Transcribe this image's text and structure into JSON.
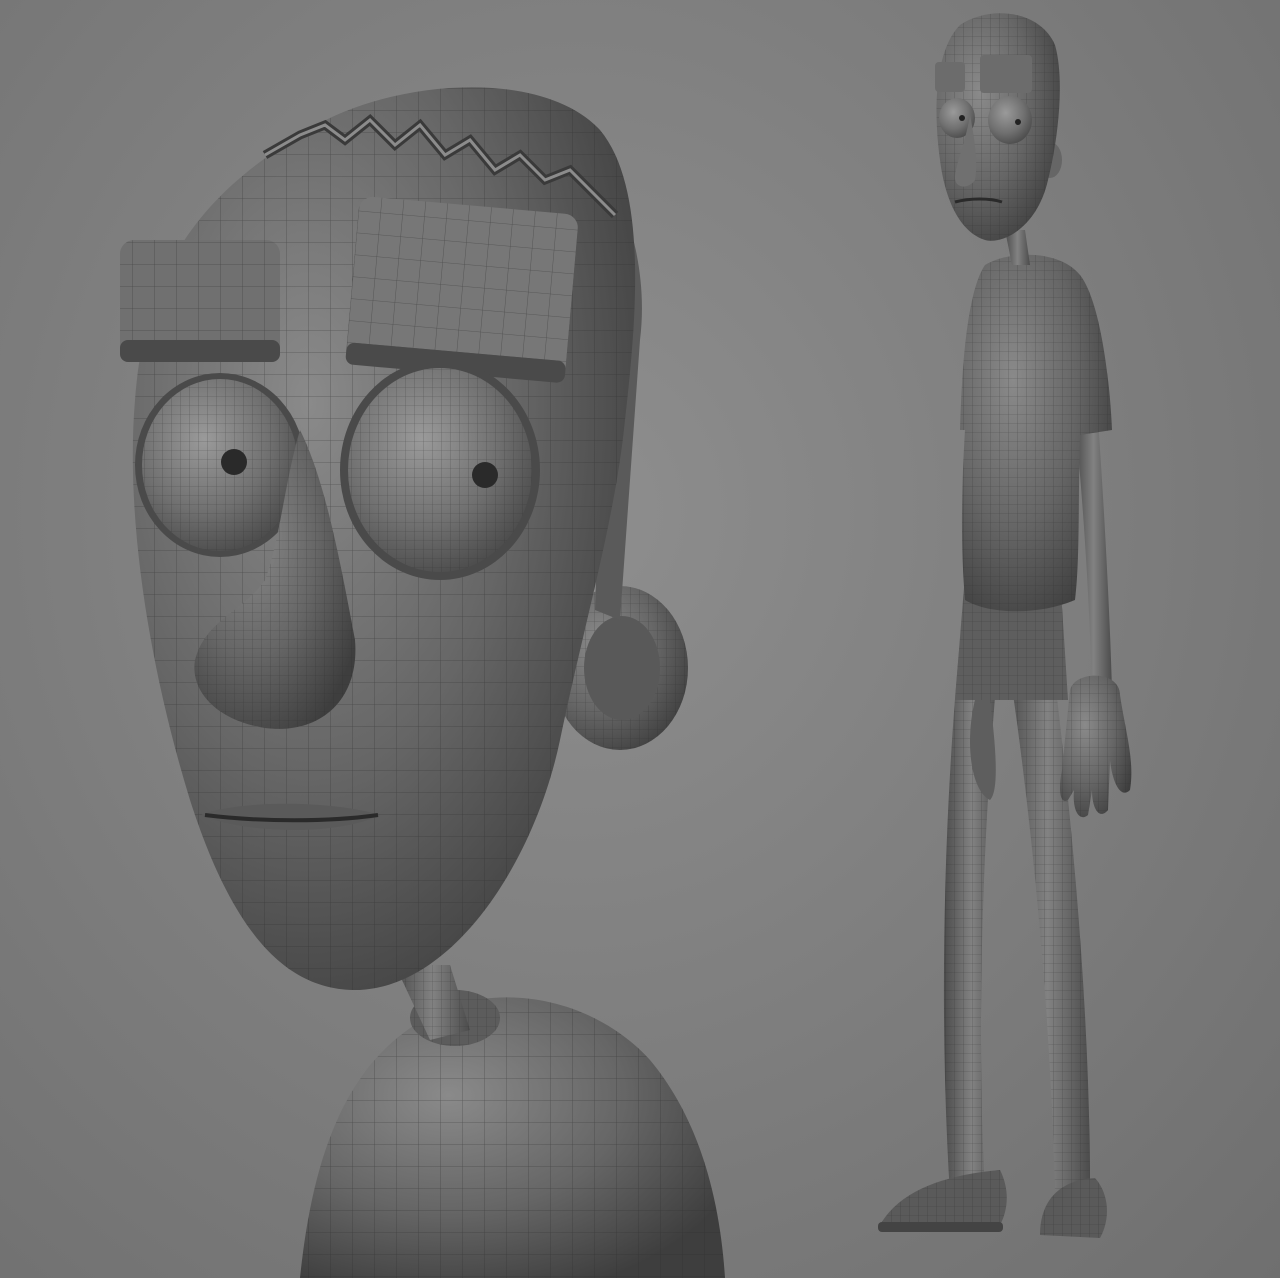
{
  "scene": {
    "background_color": "#808080",
    "model_color": "#6b6b6b",
    "wireframe_color": "#2a2a2a",
    "views": [
      {
        "name": "head-closeup"
      },
      {
        "name": "full-body-side"
      }
    ]
  }
}
